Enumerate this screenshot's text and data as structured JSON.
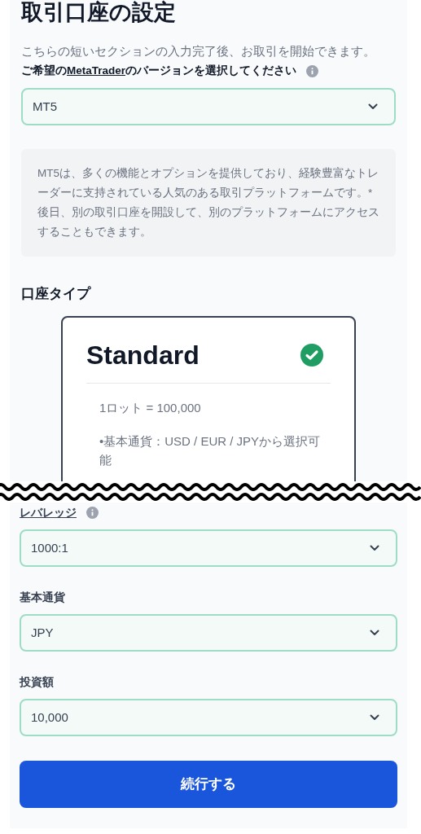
{
  "title": "取引口座の設定",
  "description": "こちらの短いセクションの入力完了後、お取引を開始できます。",
  "platform_prompt": {
    "before": "ご希望の",
    "link": "MetaTrader",
    "after": "のバージョンを選択してください"
  },
  "platform_select": {
    "value": "MT5"
  },
  "platform_info": "MT5は、多くの機能とオプションを提供しており、経験豊富なトレーダーに支持されている人気のある取引プラットフォームです。*後日、別の取引口座を開設して、別のプラットフォームにアクセスすることもできます。",
  "account_type": {
    "heading": "口座タイプ",
    "cards": [
      {
        "name": "Standard",
        "selected": true,
        "features": [
          "1ロット = 100,000",
          "•基本通貨：USD / EUR / JPYから選択可能"
        ]
      }
    ]
  },
  "fields": [
    {
      "label": "レバレッジ",
      "info": true,
      "value": "1000:1"
    },
    {
      "label": "基本通貨",
      "info": false,
      "value": "JPY"
    },
    {
      "label": "投資額",
      "info": false,
      "value": "10,000"
    }
  ],
  "continue_button": "続行する"
}
